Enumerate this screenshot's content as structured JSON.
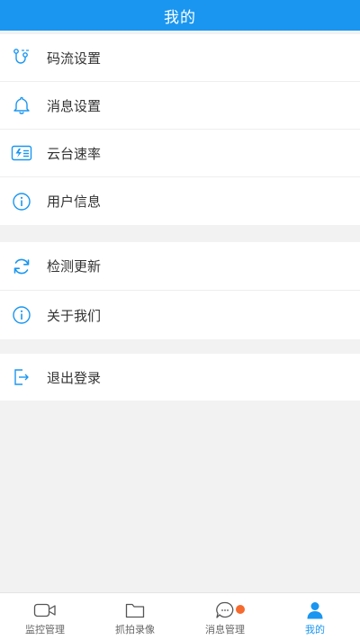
{
  "header": {
    "title": "我的"
  },
  "menu": {
    "group1": [
      {
        "label": "码流设置",
        "icon": "stream-settings-icon"
      },
      {
        "label": "消息设置",
        "icon": "bell-icon"
      },
      {
        "label": "云台速率",
        "icon": "ptz-speed-icon"
      },
      {
        "label": "用户信息",
        "icon": "info-icon"
      }
    ],
    "group2": [
      {
        "label": "检测更新",
        "icon": "refresh-icon"
      },
      {
        "label": "关于我们",
        "icon": "info-icon"
      }
    ],
    "group3": [
      {
        "label": "退出登录",
        "icon": "logout-icon"
      }
    ]
  },
  "tabbar": {
    "tabs": [
      {
        "label": "监控管理",
        "icon": "video-camera-icon"
      },
      {
        "label": "抓拍录像",
        "icon": "folder-icon"
      },
      {
        "label": "消息管理",
        "icon": "chat-bubble-icon"
      },
      {
        "label": "我的",
        "icon": "person-icon"
      }
    ],
    "active_index": 3
  },
  "colors": {
    "accent": "#1a96f0",
    "badge": "#f56a2e",
    "background": "#f2f2f2"
  }
}
